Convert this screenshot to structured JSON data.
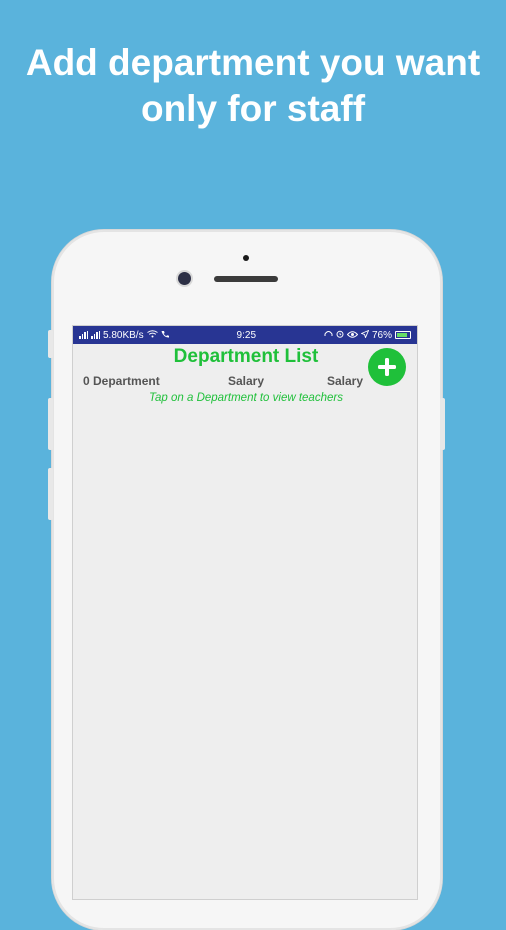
{
  "headline": {
    "line1": "Add department you want",
    "line2": "only for staff"
  },
  "status_bar": {
    "network_speed": "5.80KB/s",
    "time": "9:25",
    "battery": "76%"
  },
  "screen": {
    "title": "Department List",
    "add_button_icon": "plus-icon",
    "columns": [
      "0 Department",
      "Salary",
      "Salary"
    ],
    "hint": "Tap on a Department to view teachers"
  },
  "colors": {
    "background": "#5ab3dc",
    "accent_green": "#1fc03a",
    "status_bar": "#283593"
  }
}
